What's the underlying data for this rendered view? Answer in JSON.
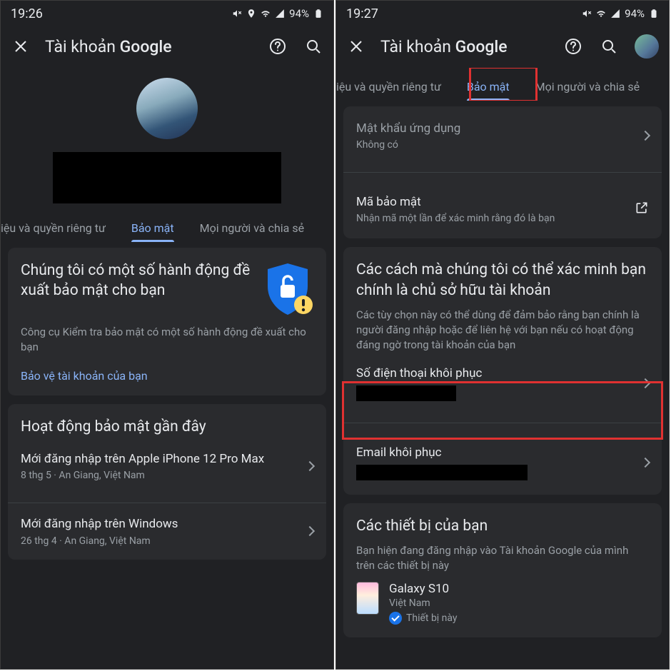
{
  "left": {
    "status": {
      "time": "19:26",
      "battery": "94%"
    },
    "appbar": {
      "title_prefix": "Tài khoản ",
      "title_brand": "Google"
    },
    "tabs": {
      "prev": "iệu và quyền riêng tư",
      "active": "Bảo mật",
      "next": "Mọi người và chia sẻ"
    },
    "security_card": {
      "title": "Chúng tôi có một số hành động đề xuất bảo mật cho bạn",
      "sub": "Công cụ Kiểm tra bảo mật có một số hành động đề xuất cho bạn",
      "link": "Bảo vệ tài khoản của bạn"
    },
    "activity_card": {
      "title": "Hoạt động bảo mật gần đây",
      "items": [
        {
          "t1": "Mới đăng nhập trên Apple iPhone 12 Pro Max",
          "t2": "8 thg 5 · An Giang, Việt Nam"
        },
        {
          "t1": "Mới đăng nhập trên Windows",
          "t2": "26 thg 4 · An Giang, Việt Nam"
        }
      ]
    }
  },
  "right": {
    "status": {
      "time": "19:27",
      "battery": "94%"
    },
    "appbar": {
      "title_prefix": "Tài khoản ",
      "title_brand": "Google"
    },
    "tabs": {
      "prev": "iệu và quyền riêng tư",
      "active": "Bảo mật",
      "next": "Mọi người và chia sẻ"
    },
    "signin_card": {
      "app_pw_label": "Mật khẩu ứng dụng",
      "app_pw_value": "Không có",
      "code_label": "Mã bảo mật",
      "code_sub": "Nhận mã một lần để xác minh rằng đó là bạn"
    },
    "verify_card": {
      "title": "Các cách mà chúng tôi có thể xác minh bạn chính là chủ sở hữu tài khoản",
      "sub": "Các tùy chọn này có thể dùng để đảm bảo rằng bạn chính là người đăng nhập hoặc để liên hệ với bạn nếu có hoạt động đáng ngờ trong tài khoản của bạn",
      "phone_label": "Số điện thoại khôi phục",
      "email_label": "Email khôi phục"
    },
    "devices_card": {
      "title": "Các thiết bị của bạn",
      "sub": "Bạn hiện đang đăng nhập vào Tài khoản Google của mình trên các thiết bị này",
      "device": {
        "name": "Galaxy S10",
        "loc": "Việt Nam",
        "this": "Thiết bị này"
      }
    }
  }
}
